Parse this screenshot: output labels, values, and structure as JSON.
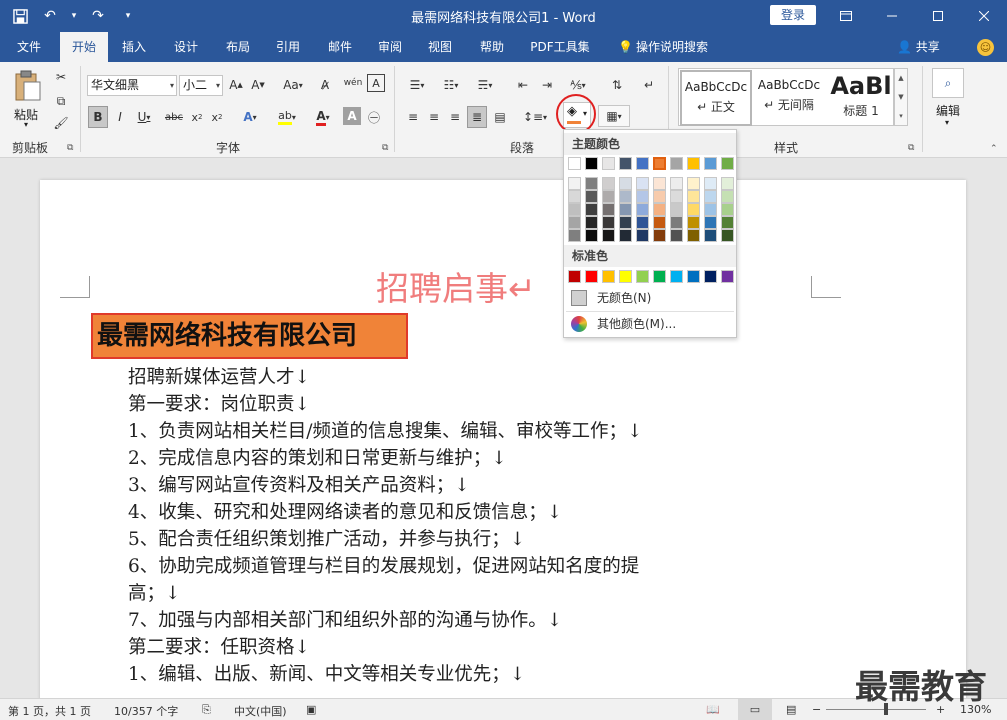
{
  "window": {
    "title": "最需网络科技有限公司1  -  Word",
    "login_label": "登录"
  },
  "tabs": [
    {
      "label": "文件"
    },
    {
      "label": "开始"
    },
    {
      "label": "插入"
    },
    {
      "label": "设计"
    },
    {
      "label": "布局"
    },
    {
      "label": "引用"
    },
    {
      "label": "邮件"
    },
    {
      "label": "审阅"
    },
    {
      "label": "视图"
    },
    {
      "label": "帮助"
    },
    {
      "label": "PDF工具集"
    },
    {
      "label": "操作说明搜索"
    }
  ],
  "share_label": "共享",
  "ribbon": {
    "clipboard": {
      "label": "剪贴板",
      "paste_label": "粘贴"
    },
    "font": {
      "label": "字体",
      "font_name": "华文细黑",
      "font_size": "小二",
      "char_label": "Aa",
      "phonetic_label": "wén",
      "enclose_label": "A"
    },
    "paragraph": {
      "label": "段落"
    },
    "styles": {
      "label": "样式",
      "items": [
        {
          "preview": "AaBbCcDc",
          "name": "↵ 正文"
        },
        {
          "preview": "AaBbCcDc",
          "name": "↵ 无间隔"
        },
        {
          "preview": "AaBl",
          "name": "标题 1"
        }
      ]
    },
    "editing": {
      "label": "编辑"
    }
  },
  "shading_dropdown": {
    "theme_label": "主题颜色",
    "standard_label": "标准色",
    "no_color_label": "无颜色(N)",
    "more_colors_label": "其他颜色(M)...",
    "theme_top": [
      "#ffffff",
      "#000000",
      "#e7e6e6",
      "#44546a",
      "#4472c4",
      "#ed7d31",
      "#a5a5a5",
      "#ffc000",
      "#5b9bd5",
      "#70ad47"
    ],
    "theme_shades": [
      [
        "#f2f2f2",
        "#7f7f7f",
        "#d0cece",
        "#d6dce4",
        "#d9e2f3",
        "#fbe5d5",
        "#ededed",
        "#fff2cc",
        "#deebf6",
        "#e2efd9"
      ],
      [
        "#d8d8d8",
        "#595959",
        "#aeabab",
        "#adb9ca",
        "#b4c6e7",
        "#f7cbac",
        "#dbdbdb",
        "#fee599",
        "#bdd7ee",
        "#c5e0b3"
      ],
      [
        "#bfbfbf",
        "#3f3f3f",
        "#757070",
        "#8496b0",
        "#8eaadb",
        "#f4b183",
        "#c9c9c9",
        "#ffd965",
        "#9dc3e6",
        "#a8d08d"
      ],
      [
        "#a5a5a5",
        "#262626",
        "#3a3838",
        "#323f4f",
        "#2f5496",
        "#c55a11",
        "#7b7b7b",
        "#bf9000",
        "#2e75b5",
        "#538135"
      ],
      [
        "#7f7f7f",
        "#0c0c0c",
        "#171616",
        "#222a35",
        "#1f3864",
        "#833c0b",
        "#525252",
        "#7f6000",
        "#1e4e79",
        "#375623"
      ]
    ],
    "standard_colors": [
      "#c00000",
      "#ff0000",
      "#ffc000",
      "#ffff00",
      "#92d050",
      "#00b050",
      "#00b0f0",
      "#0070c0",
      "#002060",
      "#7030a0"
    ]
  },
  "document": {
    "heading": "招聘启事↵",
    "company": "最需网络科技有限公司",
    "lines": [
      "招聘新媒体运营人才↓",
      "第一要求：岗位职责↓",
      "1、负责网站相关栏目/频道的信息搜集、编辑、审校等工作；↓",
      "2、完成信息内容的策划和日常更新与维护；↓",
      "3、编写网站宣传资料及相关产品资料；↓",
      "4、收集、研究和处理网络读者的意见和反馈信息；↓",
      "5、配合责任组织策划推广活动，并参与执行；↓",
      "6、协助完成频道管理与栏目的发展规划，促进网站知名度的提",
      "高；↓",
      "7、加强与内部相关部门和组织外部的沟通与协作。↓",
      "第二要求：任职资格↓",
      "1、编辑、出版、新闻、中文等相关专业优先；↓"
    ]
  },
  "status": {
    "page": "第 1 页，共 1 页",
    "words": "10/357 个字",
    "language": "中文(中国)",
    "zoom": "130%"
  },
  "watermark": "最需教育",
  "colors": {
    "accent": "#2b579a",
    "company_fill": "#f08338",
    "company_border": "#e03a2a",
    "heading_text": "#f07d7d",
    "highlight_circle": "#e02020"
  }
}
